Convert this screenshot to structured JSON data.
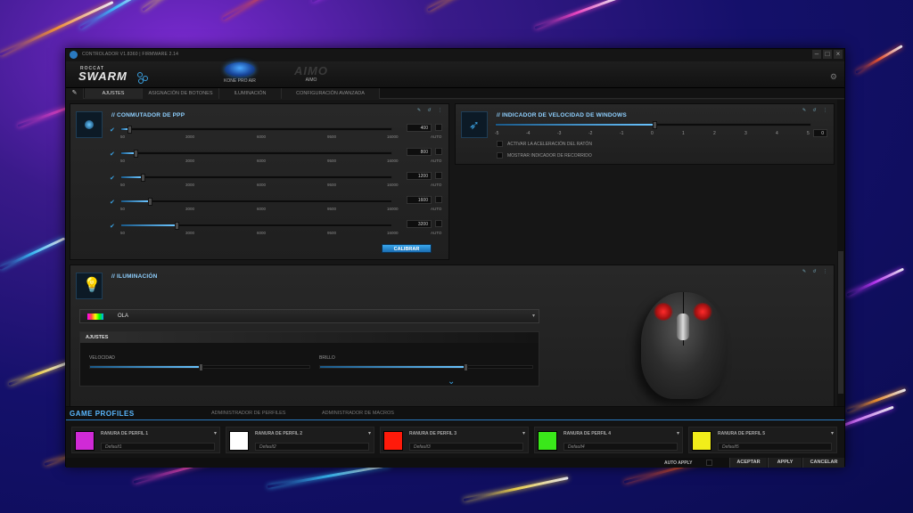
{
  "titlebar": {
    "text": "CONTROLADOR V1.8360 | FIRMWARE 2.14",
    "win_controls": [
      "–",
      "□",
      "×"
    ]
  },
  "header": {
    "brand_small": "ROCCAT",
    "brand_big": "SWARM",
    "devices": [
      {
        "label": "KONE PRO AIR",
        "selected": true
      },
      {
        "label": "AIMO",
        "logo": "AIMO",
        "selected": false
      }
    ],
    "settings_icon": "gear-icon"
  },
  "tabs": [
    {
      "label": "AJUSTES",
      "active": true
    },
    {
      "label": "ASIGNACIÓN DE BOTONES"
    },
    {
      "label": "ILUMINACIÓN"
    },
    {
      "label": "CONFIGURACIÓN AVANZADA"
    }
  ],
  "dpi": {
    "title": "// CONMUTADOR DE PPP",
    "ticks": [
      "50",
      "3000",
      "6000",
      "9500",
      "16000"
    ],
    "auto_label": "AUTO",
    "calibrate_label": "CALIBRAR",
    "rows": [
      {
        "value": "400",
        "checked": true,
        "level": 0.022
      },
      {
        "value": "800",
        "checked": true,
        "level": 0.047
      },
      {
        "value": "1200",
        "checked": true,
        "level": 0.072
      },
      {
        "value": "1600",
        "checked": true,
        "level": 0.097
      },
      {
        "value": "3200",
        "checked": true,
        "level": 0.198
      }
    ]
  },
  "pointer": {
    "title": "// INDICADOR DE VELOCIDAD DE WINDOWS",
    "scale": [
      "-5",
      "-4",
      "-3",
      "-2",
      "-1",
      "0",
      "1",
      "2",
      "3",
      "4",
      "5"
    ],
    "value": "0",
    "level": 0.5,
    "options": [
      "ACTIVAR LA ACELERACIÓN DEL RATÓN",
      "MOSTRAR INDICADOR DE RECORRIDO"
    ]
  },
  "lighting": {
    "title": "// ILUMINACIÓN",
    "effect": "OLA",
    "settings_title": "AJUSTES",
    "speed_label": "VELOCIDAD",
    "speed_level": 0.5,
    "brightness_label": "BRILLO",
    "brightness_level": 0.68,
    "accent": "#ff2a2a"
  },
  "footer": {
    "title": "GAME PROFILES",
    "tabs": [
      "ADMINISTRADOR DE PERFILES",
      "ADMINISTRADOR DE MACROS"
    ],
    "profiles": [
      {
        "slot": "RANURA DE PERFIL 1",
        "name": "Default1",
        "color": "#d02ad6"
      },
      {
        "slot": "RANURA DE PERFIL 2",
        "name": "Default2",
        "color": "#ffffff"
      },
      {
        "slot": "RANURA DE PERFIL 3",
        "name": "Default3",
        "color": "#ff1a0a"
      },
      {
        "slot": "RANURA DE PERFIL 4",
        "name": "Default4",
        "color": "#3ae81a"
      },
      {
        "slot": "RANURA DE PERFIL 5",
        "name": "Default5",
        "color": "#f2ee1a"
      }
    ],
    "auto_apply_label": "AUTO APPLY",
    "accept_label": "ACEPTAR",
    "apply_label": "APPLY",
    "cancel_label": "CANCELAR"
  }
}
